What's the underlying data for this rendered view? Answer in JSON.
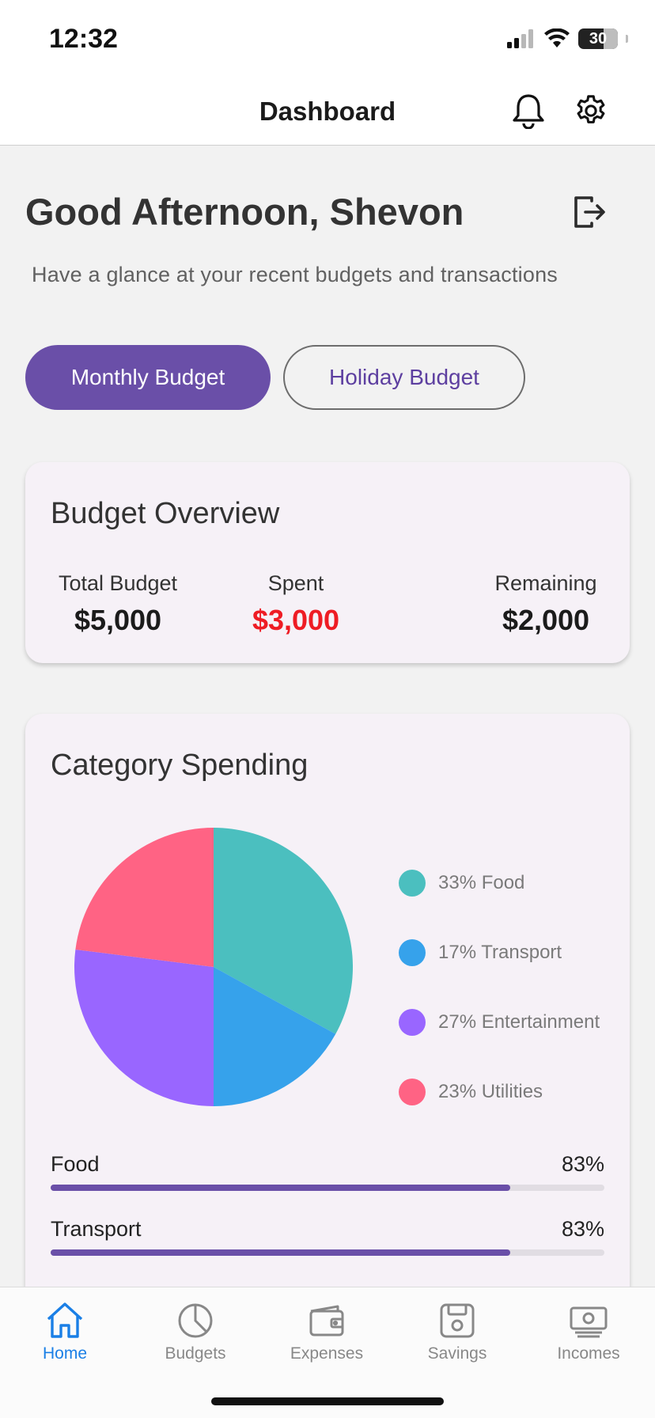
{
  "status_bar": {
    "time": "12:32",
    "battery": "30"
  },
  "header": {
    "title": "Dashboard",
    "notification_icon": "bell-icon",
    "settings_icon": "gear-icon"
  },
  "greeting": {
    "title": "Good Afternoon, Shevon",
    "subtitle": "Have a glance at your recent budgets and transactions",
    "logout_icon": "logout-icon"
  },
  "budget_tabs": [
    {
      "label": "Monthly Budget",
      "active": true
    },
    {
      "label": "Holiday Budget",
      "active": false
    }
  ],
  "overview": {
    "title": "Budget Overview",
    "total_label": "Total Budget",
    "total_value": "$5,000",
    "spent_label": "Spent",
    "spent_value": "$3,000",
    "remaining_label": "Remaining",
    "remaining_value": "$2,000"
  },
  "category_spending": {
    "title": "Category Spending",
    "legend": [
      {
        "label": "33% Food",
        "color": "#4bbfbf"
      },
      {
        "label": "17% Transport",
        "color": "#36a2eb"
      },
      {
        "label": "27% Entertainment",
        "color": "#9966ff"
      },
      {
        "label": "23% Utilities",
        "color": "#ff6384"
      }
    ],
    "bars": [
      {
        "name": "Food",
        "percent_label": "83%",
        "fraction": 0.83
      },
      {
        "name": "Transport",
        "percent_label": "83%",
        "fraction": 0.83
      }
    ]
  },
  "chart_data": {
    "type": "pie",
    "categories": [
      "Food",
      "Transport",
      "Entertainment",
      "Utilities"
    ],
    "values": [
      33,
      17,
      27,
      23
    ],
    "colors": [
      "#4bbfbf",
      "#36a2eb",
      "#9966ff",
      "#ff6384"
    ]
  },
  "bottom_nav": [
    {
      "label": "Home",
      "icon": "home-icon",
      "active": true
    },
    {
      "label": "Budgets",
      "icon": "pie-chart-icon",
      "active": false
    },
    {
      "label": "Expenses",
      "icon": "wallet-icon",
      "active": false
    },
    {
      "label": "Savings",
      "icon": "save-icon",
      "active": false
    },
    {
      "label": "Incomes",
      "icon": "money-icon",
      "active": false
    }
  ],
  "colors": {
    "accent": "#6a4fa8",
    "spent": "#ee1c24",
    "nav_active": "#1a7fe6"
  }
}
